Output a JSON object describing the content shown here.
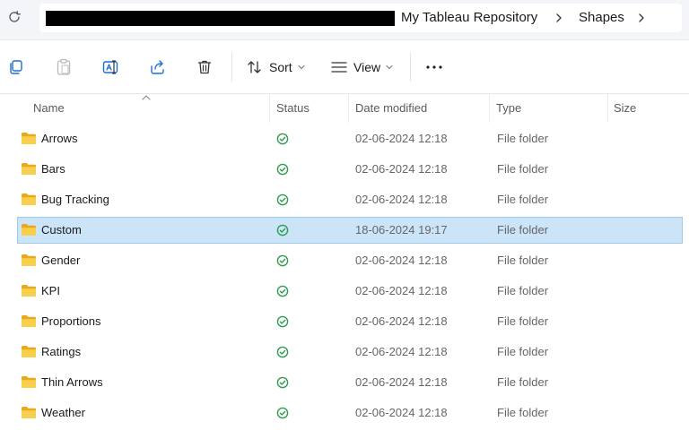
{
  "address": {
    "crumbs": [
      "My Tableau Repository",
      "Shapes"
    ]
  },
  "toolbar": {
    "sort_label": "Sort",
    "view_label": "View",
    "more_label": "..."
  },
  "columns": {
    "name": "Name",
    "status": "Status",
    "date_modified": "Date modified",
    "type": "Type",
    "size": "Size"
  },
  "files": [
    {
      "name": "Arrows",
      "date": "02-06-2024 12:18",
      "type": "File folder",
      "selected": false
    },
    {
      "name": "Bars",
      "date": "02-06-2024 12:18",
      "type": "File folder",
      "selected": false
    },
    {
      "name": "Bug Tracking",
      "date": "02-06-2024 12:18",
      "type": "File folder",
      "selected": false
    },
    {
      "name": "Custom",
      "date": "18-06-2024 19:17",
      "type": "File folder",
      "selected": true
    },
    {
      "name": "Gender",
      "date": "02-06-2024 12:18",
      "type": "File folder",
      "selected": false
    },
    {
      "name": "KPI",
      "date": "02-06-2024 12:18",
      "type": "File folder",
      "selected": false
    },
    {
      "name": "Proportions",
      "date": "02-06-2024 12:18",
      "type": "File folder",
      "selected": false
    },
    {
      "name": "Ratings",
      "date": "02-06-2024 12:18",
      "type": "File folder",
      "selected": false
    },
    {
      "name": "Thin Arrows",
      "date": "02-06-2024 12:18",
      "type": "File folder",
      "selected": false
    },
    {
      "name": "Weather",
      "date": "02-06-2024 12:18",
      "type": "File folder",
      "selected": false
    }
  ],
  "colors": {
    "selection_bg": "#cce4f7",
    "status_green": "#2e9d4f",
    "folder_yellow": "#f4c542"
  },
  "icons": {
    "refresh": "refresh-icon",
    "copy": "copy-icon",
    "paste": "paste-icon",
    "rename": "rename-icon",
    "share": "share-icon",
    "delete": "delete-icon",
    "sort": "sort-icon",
    "view": "view-icon",
    "more": "more-icon",
    "folder": "folder-icon",
    "status": "sync-ok-icon"
  }
}
